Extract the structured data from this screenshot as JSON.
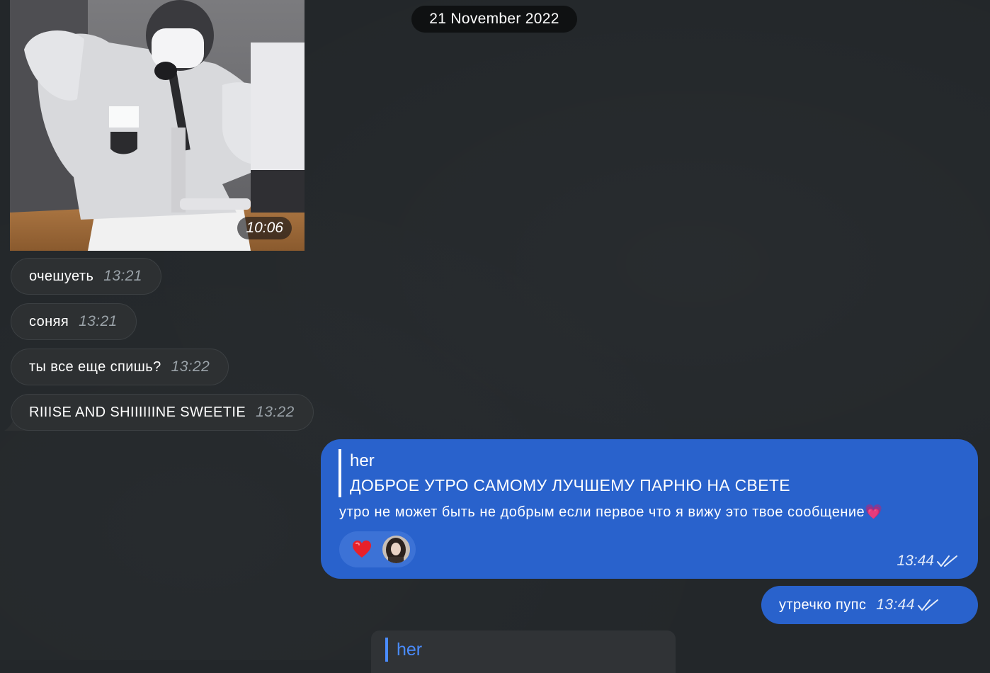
{
  "date_separator": "21 November 2022",
  "media": {
    "time": "10:06"
  },
  "incoming": [
    {
      "text": "очешуеть",
      "time": "13:21"
    },
    {
      "text": "соняя",
      "time": "13:21"
    },
    {
      "text": "ты все еще спишь?",
      "time": "13:22"
    },
    {
      "text": "RIIISE AND SHIIIIIINE SWEETIE",
      "time": "13:22"
    }
  ],
  "outgoing_reply": {
    "reply_to_name": "her",
    "reply_to_text": "ДОБРОЕ УТРО САМОМУ ЛУЧШЕМУ ПАРНЮ НА СВЕТЕ",
    "text": "утро не может быть не добрым если первое что я вижу это твое сообщение💗",
    "time": "13:44",
    "reaction_icon": "heart-icon"
  },
  "outgoing_short": {
    "text": "утречко пупс",
    "time": "13:44"
  },
  "partial_reply": {
    "reply_to_name": "her"
  },
  "colors": {
    "background": "#23272a",
    "incoming_bubble": "#2d3032",
    "outgoing_bubble": "#2962cc",
    "reply_name_accent": "#4a8cff"
  }
}
